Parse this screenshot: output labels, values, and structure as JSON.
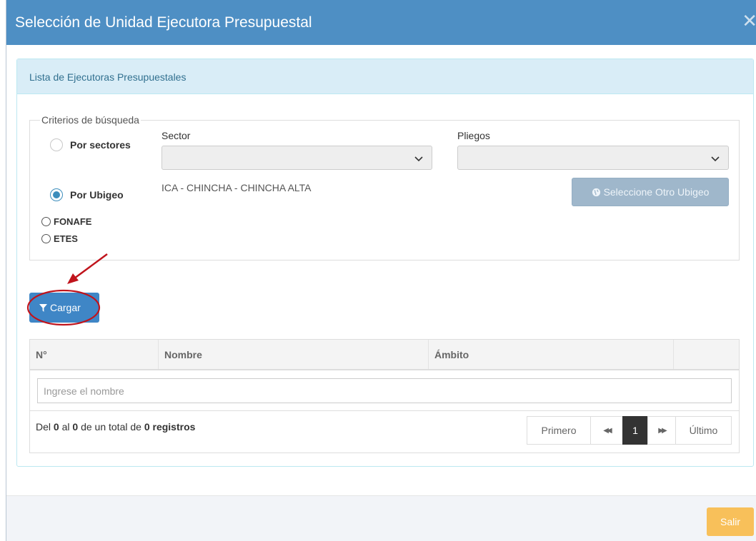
{
  "modal": {
    "title": "Selección de Unidad Ejecutora Presupuestal",
    "close_symbol": "✕"
  },
  "panel": {
    "heading": "Lista de Ejecutoras Presupuestales"
  },
  "criteria": {
    "legend": "Criterios de búsqueda",
    "options": {
      "sectores": "Por sectores",
      "ubigeo": "Por Ubigeo",
      "fonafe": "FONAFE",
      "etes": "ETES"
    },
    "selected": "ubigeo",
    "sector_label": "Sector",
    "sector_value": "",
    "pliegos_label": "Pliegos",
    "pliegos_value": "",
    "ubigeo_value": "ICA - CHINCHA - CHINCHA ALTA",
    "ubigeo_button": "Seleccione Otro Ubigeo"
  },
  "actions": {
    "cargar_label": "Cargar"
  },
  "table": {
    "columns": [
      "N°",
      "Nombre",
      "Ámbito",
      ""
    ],
    "filter_placeholder": "Ingrese el nombre",
    "rows": [],
    "info": {
      "prefix": "Del",
      "from": "0",
      "mid": "al",
      "to": "0",
      "mid2": "de un total de",
      "total_text": "0 registros"
    },
    "pagination": {
      "first": "Primero",
      "prev": "◀◀",
      "current": "1",
      "next": "▶▶",
      "last": "Último"
    }
  },
  "footer": {
    "salir_label": "Salir"
  },
  "colors": {
    "header": "#4e8fc4",
    "primary_button": "#3f86c6",
    "disabled_button": "#9fb7cb",
    "warning_button": "#f8c05a",
    "panel_heading_bg": "#d9edf7",
    "annotation_red": "#c0141c"
  }
}
